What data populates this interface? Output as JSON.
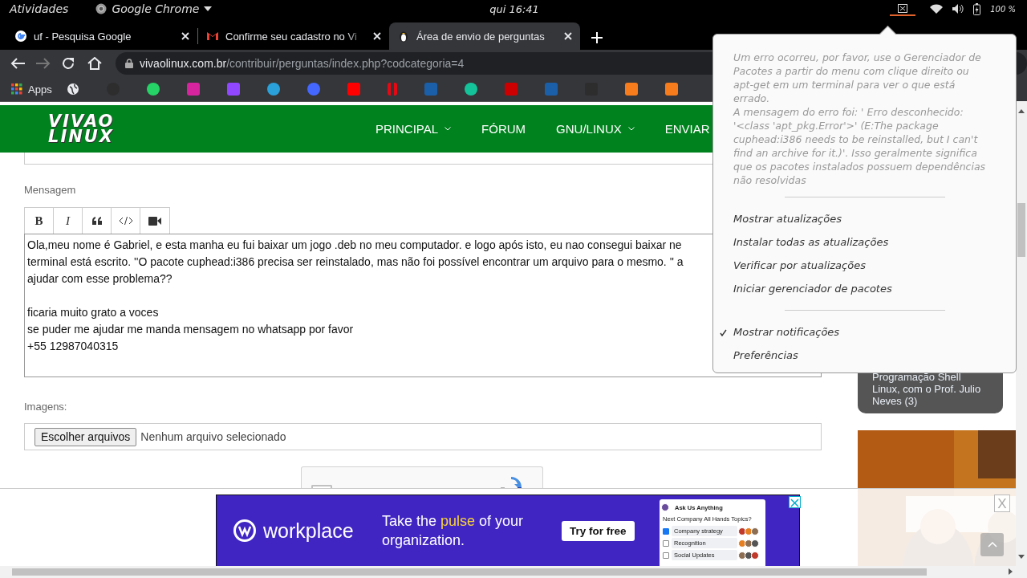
{
  "top_bar": {
    "activities": "Atividades",
    "app": "Google Chrome",
    "clock": "qui 16:41",
    "battery": "100 %"
  },
  "tabs": [
    {
      "title": "uf - Pesquisa Google",
      "selected": false
    },
    {
      "title": "Confirme seu cadastro no Vi",
      "selected": false
    },
    {
      "title": "Área de envio de perguntas",
      "selected": true
    }
  ],
  "address_bar": {
    "domain": "vivaolinux.com.br",
    "path": "/contribuir/perguntas/index.php?codcategoria=4"
  },
  "bookmarks_bar": {
    "apps_label": "Apps"
  },
  "site_header": {
    "logo": [
      "VIVAO",
      "LINUX"
    ],
    "nav": [
      {
        "label": "PRINCIPAL",
        "dropdown": true
      },
      {
        "label": "FÓRUM",
        "dropdown": false
      },
      {
        "label": "GNU/LINUX",
        "dropdown": true
      },
      {
        "label": "ENVIAR",
        "dropdown": false
      }
    ]
  },
  "form": {
    "message_label": "Mensagem",
    "toolbar": [
      {
        "kind": "bold",
        "label": "B"
      },
      {
        "kind": "italic",
        "label": "I"
      },
      {
        "kind": "quote"
      },
      {
        "kind": "code"
      },
      {
        "kind": "video"
      }
    ],
    "message_paragraphs": [
      [
        "Ola,meu nome é Gabriel, e esta manha eu fui baixar um jogo .deb no meu computador. e logo após isto, eu nao consegui baixar ne",
        "terminal está escrito. ''O pacote cuphead:i386 precisa ser reinstalado, mas não foi possível encontrar um arquivo para o mesmo. '' a",
        "ajudar com esse  problema??"
      ],
      [
        "ficaria muito grato a voces",
        "se puder me ajudar me manda mensagem no whatsapp por favor",
        "+55 12987040315"
      ]
    ],
    "images_label": "Imagens:",
    "file_button": "Escolher arquivos",
    "file_status": "Nenhum arquivo selecionado",
    "captcha": {
      "checked": false
    }
  },
  "sidebar": {
    "card_text": "Programação Shell Linux, com o Prof. Julio Neves (3)",
    "ad_close": "X"
  },
  "ad_banner": {
    "logo": "workplace",
    "headline": "Take the **pulse** of your organization.",
    "cta": "Try for free",
    "poll": {
      "title": "Ask Us Anything",
      "question": "Next Company All Hands Topics?",
      "options": [
        {
          "label": "Company strategy",
          "checked": true
        },
        {
          "label": "Recognition",
          "checked": false
        },
        {
          "label": "Social Updates",
          "checked": false
        }
      ]
    }
  },
  "tray_menu": {
    "message": [
      "Um erro ocorreu, por favor, use o Gerenciador de Pacotes a partir do menu com clique direito ou apt-get em um terminal para ver o que está errado.",
      "A mensagem do erro foi: ' Erro desconhecido: '<class 'apt_pkg.Error'>' (E:The package cuphead:i386 needs to be reinstalled, but I can't find an archive for it.)'. Isso geralmente significa que os pacotes instalados possuem dependências não resolvidas"
    ],
    "groups": [
      {
        "items": [
          {
            "label": "Mostrar atualizações"
          },
          {
            "label": "Instalar todas as atualizações"
          },
          {
            "label": "Verificar por atualizações"
          },
          {
            "label": "Iniciar gerenciador de pacotes"
          }
        ]
      },
      {
        "items": [
          {
            "label": "Mostrar notificações",
            "checked": true
          },
          {
            "label": "Preferências",
            "checked": false
          }
        ]
      }
    ]
  }
}
